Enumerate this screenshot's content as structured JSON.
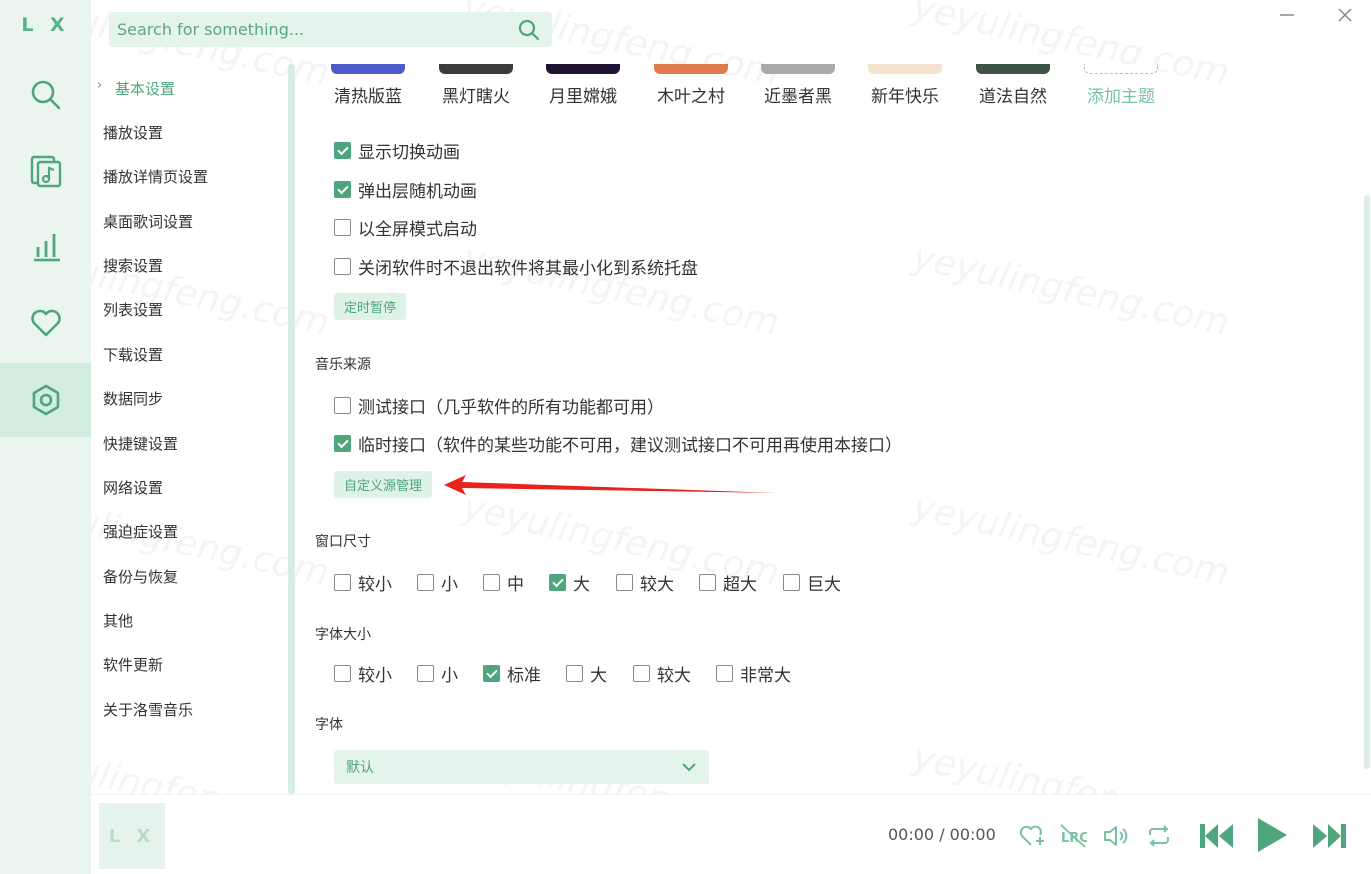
{
  "app": {
    "logo": "L X"
  },
  "header": {
    "search_placeholder": "Search for something..."
  },
  "rail": {
    "items": [
      "search-icon",
      "song-list-icon",
      "leaderboard-icon",
      "favorite-heart-icon",
      "settings-icon"
    ],
    "active": "settings-icon"
  },
  "nav": {
    "active_label": "基本设置",
    "items": [
      "播放设置",
      "播放详情页设置",
      "桌面歌词设置",
      "搜索设置",
      "列表设置",
      "下载设置",
      "数据同步",
      "快捷键设置",
      "网络设置",
      "强迫症设置",
      "备份与恢复",
      "其他",
      "软件更新",
      "关于洛雪音乐"
    ]
  },
  "themes": [
    {
      "label": "清热版蓝",
      "color": "#4d5cc7"
    },
    {
      "label": "黑灯瞎火",
      "color": "#3c3c3c"
    },
    {
      "label": "月里嫦娥",
      "color": "#1f1433"
    },
    {
      "label": "木叶之村",
      "color": "#e07a4f"
    },
    {
      "label": "近墨者黑",
      "color": "#aaaaaa"
    },
    {
      "label": "新年快乐",
      "color": "#f5e2cf"
    },
    {
      "label": "道法自然",
      "color": "#3f5246"
    },
    {
      "label": "添加主题",
      "color": "#ffffff"
    }
  ],
  "display": {
    "anim_switch": {
      "label": "显示切换动画",
      "checked": true
    },
    "popup_anim": {
      "label": "弹出层随机动画",
      "checked": true
    },
    "fullscreen": {
      "label": "以全屏模式启动",
      "checked": false
    },
    "tray": {
      "label": "关闭软件时不退出软件将其最小化到系统托盘",
      "checked": false
    },
    "timer_button": "定时暂停"
  },
  "source": {
    "title": "音乐来源",
    "test": {
      "label": "测试接口（几乎软件的所有功能都可用）",
      "checked": false
    },
    "temp": {
      "label": "临时接口（软件的某些功能不可用，建议测试接口不可用再使用本接口）",
      "checked": true
    },
    "custom_button": "自定义源管理"
  },
  "window_size": {
    "title": "窗口尺寸",
    "options": [
      {
        "label": "较小",
        "checked": false
      },
      {
        "label": "小",
        "checked": false
      },
      {
        "label": "中",
        "checked": false
      },
      {
        "label": "大",
        "checked": true
      },
      {
        "label": "较大",
        "checked": false
      },
      {
        "label": "超大",
        "checked": false
      },
      {
        "label": "巨大",
        "checked": false
      }
    ]
  },
  "font_size": {
    "title": "字体大小",
    "options": [
      {
        "label": "较小",
        "checked": false
      },
      {
        "label": "小",
        "checked": false
      },
      {
        "label": "标准",
        "checked": true
      },
      {
        "label": "大",
        "checked": false
      },
      {
        "label": "较大",
        "checked": false
      },
      {
        "label": "非常大",
        "checked": false
      }
    ]
  },
  "font": {
    "title": "字体",
    "value": "默认"
  },
  "player": {
    "cover_text": "L X",
    "time": "00:00 / 00:00"
  },
  "watermark": "yeyulingfeng.com",
  "colors": {
    "accent": "#4fa57c",
    "rail_bg": "#eaf5ef",
    "annotation_arrow": "#e8231c"
  }
}
